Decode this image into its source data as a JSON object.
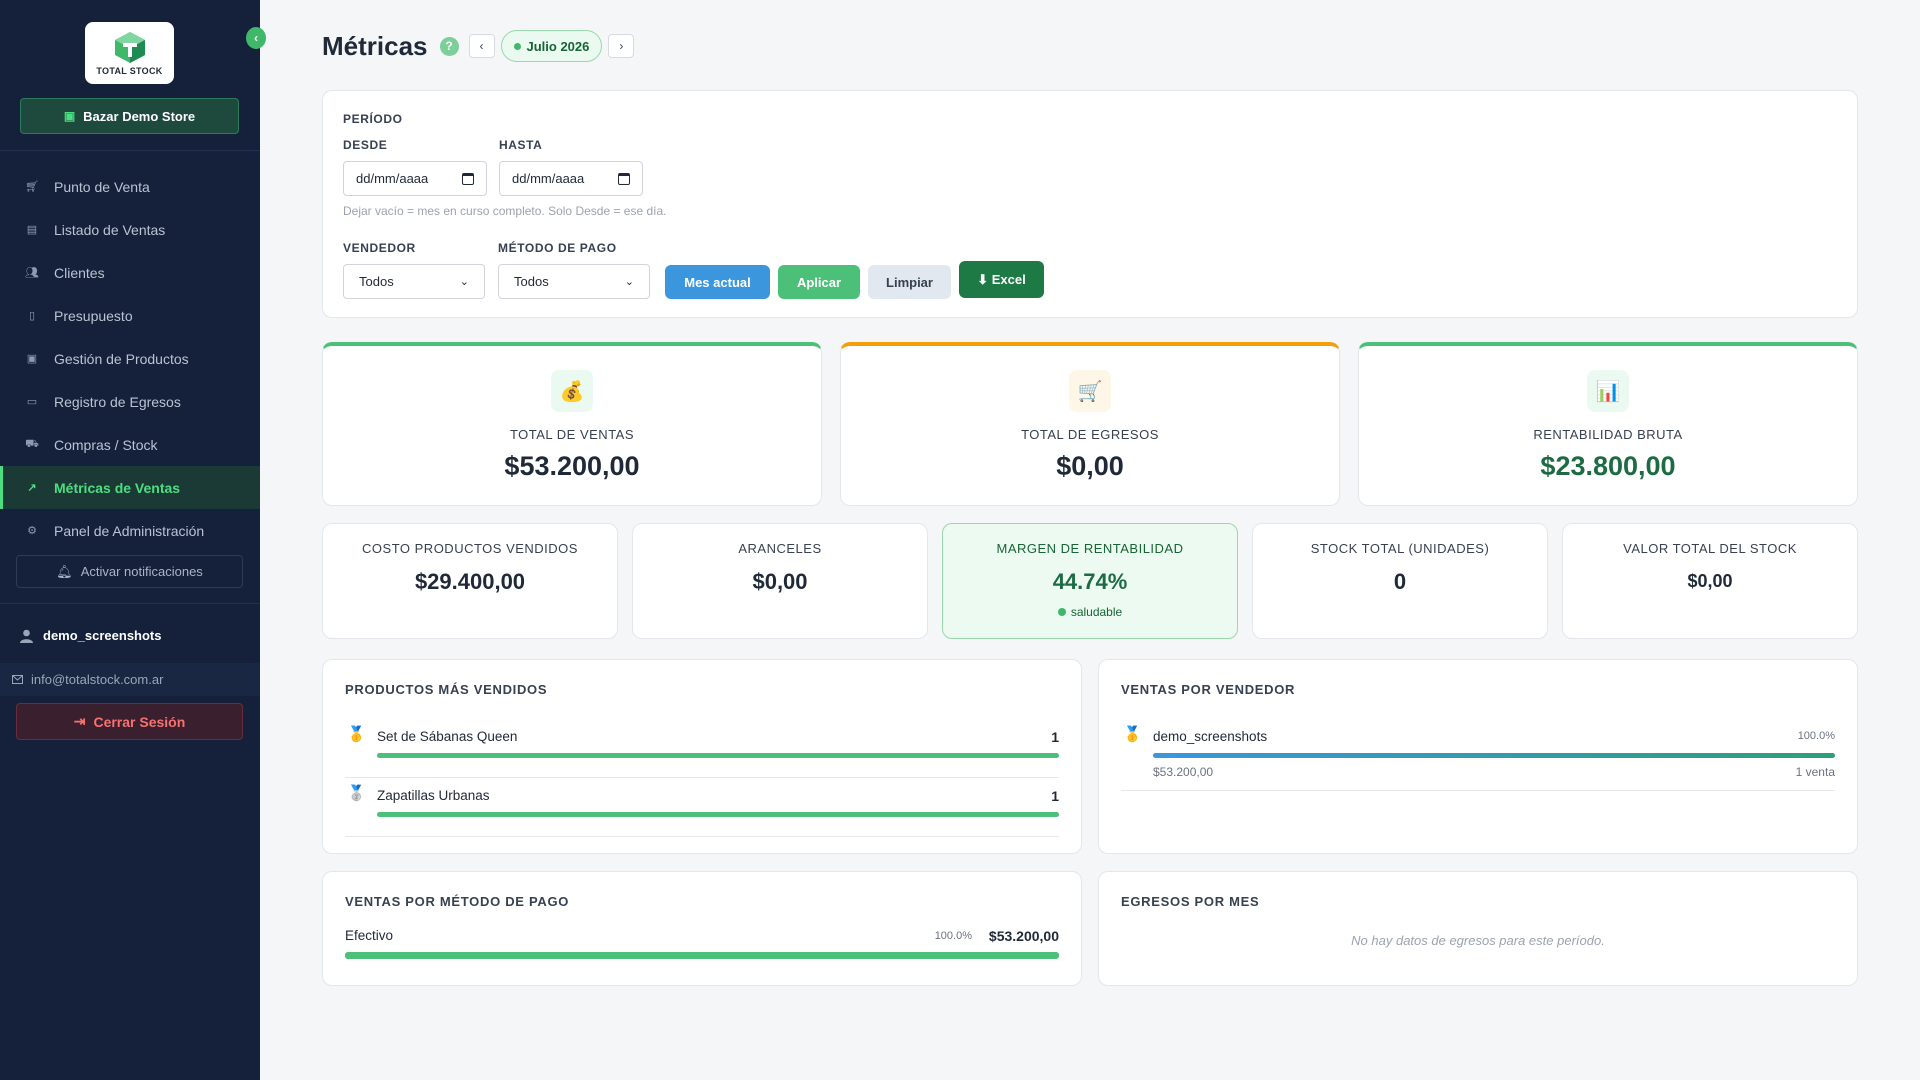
{
  "sidebar": {
    "logo_text": "TOTAL STOCK",
    "collapse_icon": "chevron-left-icon",
    "store_label": "Bazar Demo Store",
    "items": [
      {
        "label": "Punto de Venta",
        "icon": "cart-icon"
      },
      {
        "label": "Listado de Ventas",
        "icon": "list-icon"
      },
      {
        "label": "Clientes",
        "icon": "users-icon"
      },
      {
        "label": "Presupuesto",
        "icon": "file-icon"
      },
      {
        "label": "Gestión de Productos",
        "icon": "box-icon"
      },
      {
        "label": "Registro de Egresos",
        "icon": "money-icon"
      },
      {
        "label": "Compras / Stock",
        "icon": "truck-icon"
      },
      {
        "label": "Métricas de Ventas",
        "icon": "chart-icon",
        "active": true
      },
      {
        "label": "Panel de Administración",
        "icon": "gear-icon"
      }
    ],
    "notifications_label": "Activar notificaciones",
    "username": "demo_screenshots",
    "email": "info@totalstock.com.ar",
    "logout_label": "Cerrar Sesión"
  },
  "header": {
    "title": "Métricas",
    "help": "?",
    "prev": "‹",
    "next": "›",
    "month": "Julio 2026"
  },
  "filters": {
    "period_label": "PERÍODO",
    "from_label": "DESDE",
    "to_label": "HASTA",
    "from_placeholder": "dd/mm/aaaa",
    "to_placeholder": "dd/mm/aaaa",
    "hint": "Dejar vacío = mes en curso completo. Solo Desde = ese día.",
    "seller_label": "VENDEDOR",
    "seller_value": "Todos",
    "payment_label": "MÉTODO DE PAGO",
    "payment_value": "Todos",
    "btn_current_month": "Mes actual",
    "btn_apply": "Aplicar",
    "btn_clear": "Limpiar",
    "btn_excel": "⬇ Excel"
  },
  "kpis": [
    {
      "label": "TOTAL DE VENTAS",
      "value": "$53.200,00",
      "icon": "money-bag-icon",
      "accent": "#4cbf78",
      "value_color": "#1f2937",
      "icon_bg": "#eafaf0"
    },
    {
      "label": "TOTAL DE EGRESOS",
      "value": "$0,00",
      "icon": "cart-icon",
      "accent": "#f59e0b",
      "value_color": "#1f2937",
      "icon_bg": "#fef6e7"
    },
    {
      "label": "RENTABILIDAD BRUTA",
      "value": "$23.800,00",
      "icon": "bar-chart-icon",
      "accent": "#4cbf78",
      "value_color": "#1d6b43",
      "icon_bg": "#eafaf0"
    }
  ],
  "small_kpis": [
    {
      "label": "COSTO PRODUCTOS VENDIDOS",
      "value": "$29.400,00"
    },
    {
      "label": "ARANCELES",
      "value": "$0,00"
    },
    {
      "label": "MARGEN DE RENTABILIDAD",
      "value": "44.74%",
      "badge": "saludable"
    },
    {
      "label": "STOCK TOTAL (UNIDADES)",
      "value": "0"
    },
    {
      "label": "VALOR TOTAL DEL STOCK",
      "value": "$0,00"
    }
  ],
  "top_products": {
    "title": "PRODUCTOS MÁS VENDIDOS",
    "items": [
      {
        "name": "Set de Sábanas Queen",
        "count": "1",
        "medal": "gold-medal-icon",
        "share": 1.0
      },
      {
        "name": "Zapatillas Urbanas",
        "count": "1",
        "medal": "silver-medal-icon",
        "share": 1.0
      }
    ]
  },
  "sales_by_seller": {
    "title": "VENTAS POR VENDEDOR",
    "items": [
      {
        "name": "demo_screenshots",
        "pct": "100.0%",
        "amount": "$53.200,00",
        "sales": "1 venta",
        "medal": "gold-medal-icon",
        "share": 1.0
      }
    ]
  },
  "sales_by_payment": {
    "title": "VENTAS POR MÉTODO DE PAGO",
    "items": [
      {
        "name": "Efectivo",
        "pct": "100.0%",
        "amount": "$53.200,00",
        "share": 1.0
      }
    ]
  },
  "expenses_by_month": {
    "title": "EGRESOS POR MES",
    "empty": "No hay datos de egresos para este período."
  }
}
